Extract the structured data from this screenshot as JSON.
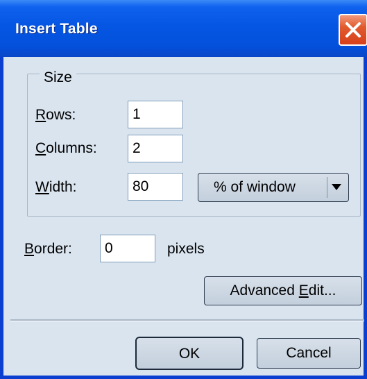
{
  "window": {
    "title": "Insert Table",
    "close_icon": "close-x-icon"
  },
  "size_group": {
    "legend": "Size",
    "rows": {
      "label_underlined": "R",
      "label_rest": "ows:",
      "value": "1"
    },
    "columns": {
      "label_underlined": "C",
      "label_rest": "olumns:",
      "value": "2"
    },
    "width": {
      "label_underlined": "W",
      "label_rest": "idth:",
      "value": "80",
      "unit_selected": "% of window",
      "unit_icon": "chevron-down-icon"
    }
  },
  "border": {
    "label_underlined": "B",
    "label_rest": "order:",
    "value": "0",
    "unit": "pixels"
  },
  "buttons": {
    "advanced_edit_prefix": "Advanced ",
    "advanced_edit_underlined": "E",
    "advanced_edit_suffix": "dit...",
    "ok": "OK",
    "cancel": "Cancel"
  },
  "colors": {
    "titlebar": "#0556e3",
    "window_bg": "#d9e4ef",
    "close_button": "#d7401a"
  }
}
